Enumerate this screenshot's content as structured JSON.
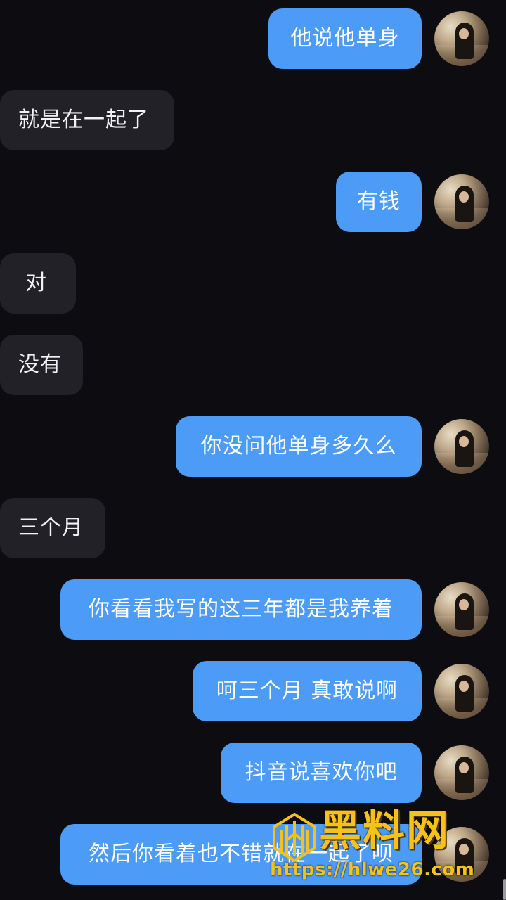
{
  "messages": [
    {
      "dir": "out",
      "text": "他说他单身"
    },
    {
      "dir": "in",
      "text": "就是在一起了"
    },
    {
      "dir": "out",
      "text": "有钱"
    },
    {
      "dir": "in",
      "text": "对"
    },
    {
      "dir": "in",
      "text": "没有"
    },
    {
      "dir": "out",
      "text": "你没问他单身多久么"
    },
    {
      "dir": "in",
      "text": "三个月"
    },
    {
      "dir": "out",
      "text": "你看看我写的这三年都是我养着"
    },
    {
      "dir": "out",
      "text": "呵三个月 真敢说啊"
    },
    {
      "dir": "out",
      "text": "抖音说喜欢你吧"
    },
    {
      "dir": "out",
      "text": "然后你看着也不错就在一起了呗"
    }
  ],
  "watermark": {
    "title": "黑料网",
    "url": "https://hlwe26.com"
  },
  "colors": {
    "background": "#0d0c11",
    "outgoing_bubble": "#4b9bf7",
    "incoming_bubble": "#222127",
    "watermark": "#f7c218"
  }
}
